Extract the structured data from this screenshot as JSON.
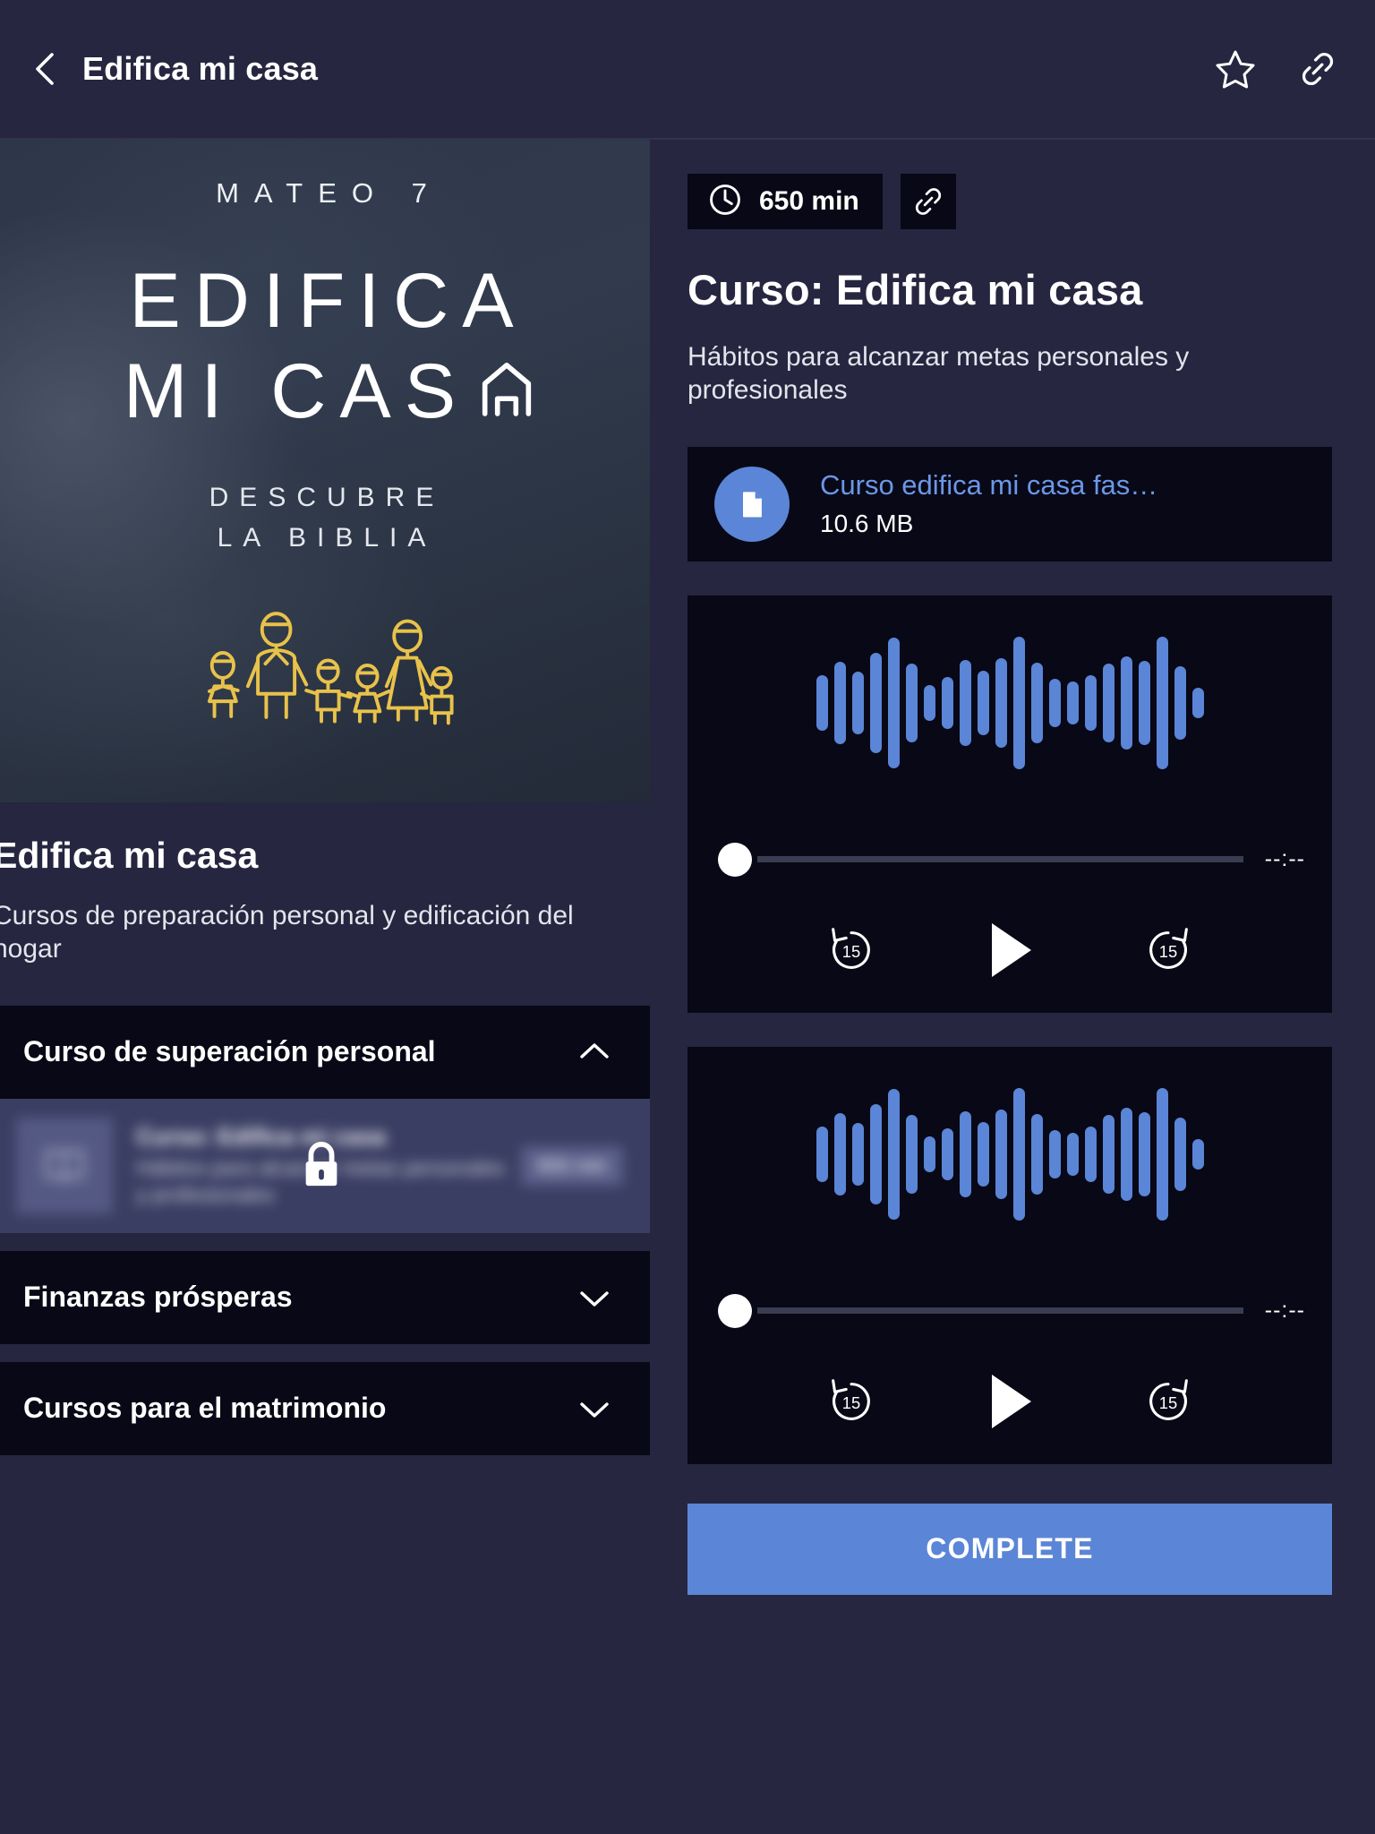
{
  "appbar": {
    "back_icon": "chevron-left-icon",
    "title": "Edifica mi casa",
    "star_icon": "star-outline-icon",
    "link_icon": "link-icon"
  },
  "cover": {
    "eyebrow": "MATEO 7",
    "line1": "EDIFICA",
    "line2": "MI CAS",
    "line2_house_glyph": "A-as-house-icon",
    "sub_line1": "DESCUBRE",
    "sub_line2": "LA BIBLIA",
    "illustration": "family-line-art-icon",
    "illustration_color": "#e8c24a"
  },
  "left": {
    "title": "Edifica mi casa",
    "description": "Cursos de preparación personal y edificación del hogar",
    "accordions": [
      {
        "label": "Curso de superación personal",
        "expanded": true,
        "chevron": "chevron-up-icon"
      },
      {
        "label": "Finanzas prósperas",
        "expanded": false,
        "chevron": "chevron-down-icon"
      },
      {
        "label": "Cursos para el matrimonio",
        "expanded": false,
        "chevron": "chevron-down-icon"
      }
    ],
    "locked_lesson": {
      "thumb_icon": "book-icon",
      "title": "Curso: Edifica mi casa",
      "description": "Hábitos para alcanzar metas personales y profesionales",
      "badge": "650 min",
      "lock_icon": "lock-icon",
      "blurred": true
    }
  },
  "right": {
    "duration_icon": "clock-icon",
    "duration": "650 min",
    "link_icon": "link-icon",
    "title": "Curso: Edifica mi casa",
    "description": "Hábitos para alcanzar metas personales y profesionales",
    "file": {
      "icon": "document-icon",
      "name": "Curso edifica mi casa fas…",
      "size": "10.6 MB"
    },
    "players": [
      {
        "rewind_label": "15",
        "forward_label": "15",
        "play_icon": "play-icon",
        "time": "--:--",
        "progress_percent": 0
      },
      {
        "rewind_label": "15",
        "forward_label": "15",
        "play_icon": "play-icon",
        "time": "--:--",
        "progress_percent": 0
      }
    ],
    "complete_label": "COMPLETE"
  },
  "waveform": {
    "bar_color": "#5b85d6",
    "heights": [
      62,
      92,
      70,
      112,
      146,
      88,
      40,
      58,
      96,
      72,
      100,
      148,
      90,
      54,
      48,
      62,
      88,
      104,
      94,
      148,
      82,
      34
    ]
  },
  "colors": {
    "page_bg": "#262640",
    "card_bg": "#080816",
    "accent": "#5b85d6",
    "link_text": "#6b97e8",
    "locked_bg": "#3a3e63"
  }
}
